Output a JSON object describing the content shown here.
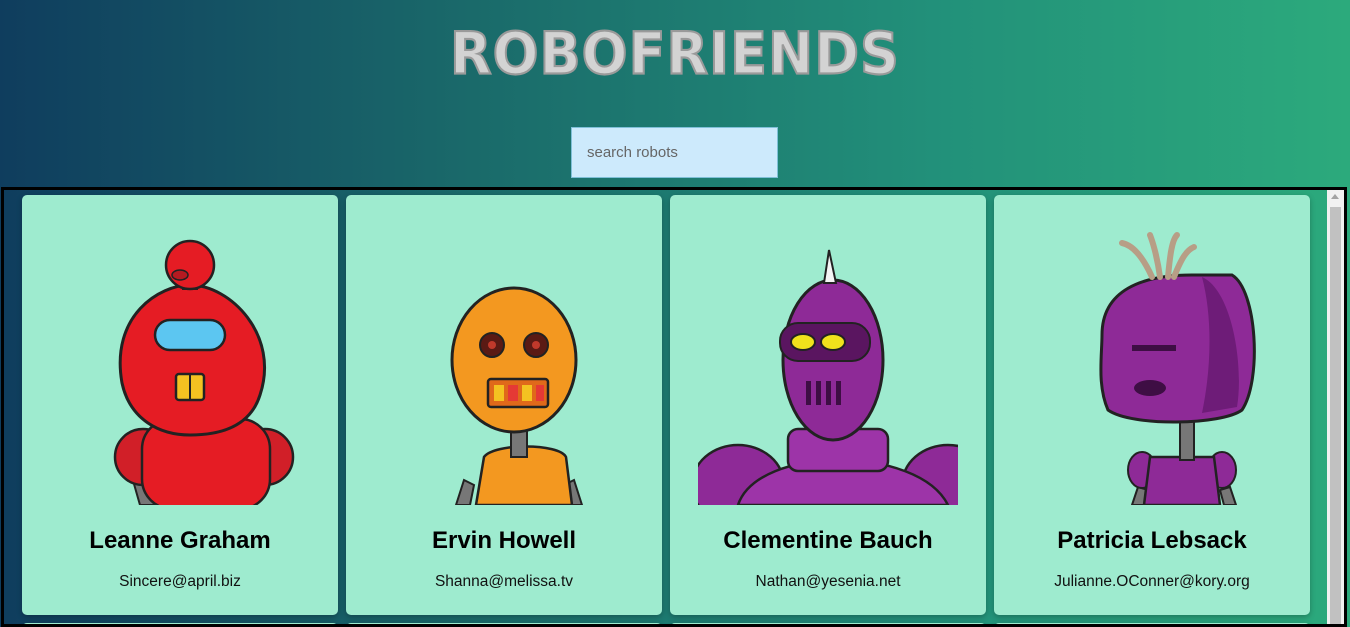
{
  "app": {
    "title": "ROBOFRIENDS"
  },
  "search": {
    "placeholder": "search robots",
    "value": ""
  },
  "robots": [
    {
      "name": "Leanne Graham",
      "email": "Sincere@april.biz",
      "image": "red-robot-icon"
    },
    {
      "name": "Ervin Howell",
      "email": "Shanna@melissa.tv",
      "image": "orange-robot-icon"
    },
    {
      "name": "Clementine Bauch",
      "email": "Nathan@yesenia.net",
      "image": "purple-robot-icon"
    },
    {
      "name": "Patricia Lebsack",
      "email": "Julianne.OConner@kory.org",
      "image": "purple-robot-icon"
    }
  ],
  "colors": {
    "card": "#9eebcf",
    "search": "#cdeafc",
    "title": "#d3d3d3"
  }
}
